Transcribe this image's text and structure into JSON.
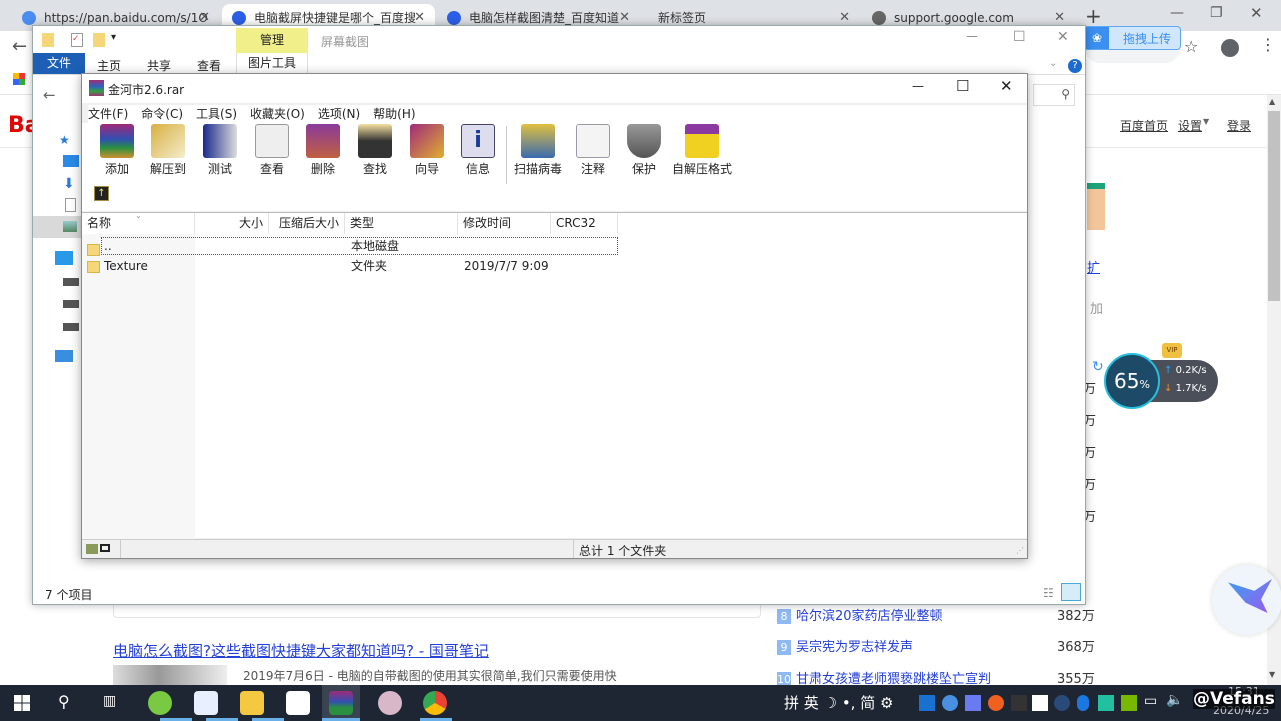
{
  "browser": {
    "tabs": [
      {
        "title": "https://pan.baidu.com/s/1O",
        "icon": "baidu-netdisk-icon"
      },
      {
        "title": "电脑截屏快捷键是哪个_百度搜",
        "icon": "baidu-paw-icon",
        "active": true
      },
      {
        "title": "电脑怎样截图清楚_百度知道",
        "icon": "baidu-paw-icon"
      },
      {
        "title": "新标签页",
        "icon": ""
      },
      {
        "title": "support.google.com",
        "icon": "globe-icon"
      }
    ],
    "upload_button": "拖拽上传"
  },
  "baidu": {
    "logo": "Ba",
    "header_links": [
      "百度首页",
      "设置",
      "登录"
    ],
    "result_title": "电脑怎么截图?这些截图快捷键大家都知道吗? - 国哥笔记",
    "result_snippet": "2019年7月6日 - 电脑的自带截图的使用其实很简单,我们只需要使用快",
    "side_fragments": [
      "扩",
      "加"
    ],
    "hot_list": [
      {
        "rank": "8",
        "title": "哈尔滨20家药店停业整顿",
        "count": "382万"
      },
      {
        "rank": "9",
        "title": "吴宗宪为罗志祥发声",
        "count": "368万"
      },
      {
        "rank": "10",
        "title": "甘肃女孩遭老师猥亵跳楼坠亡宣判",
        "count": "355万"
      }
    ],
    "count_suffix": "万"
  },
  "explorer": {
    "ribbon_tabs": [
      "文件",
      "主页",
      "共享",
      "查看"
    ],
    "context_group": "管理",
    "context_tab": "图片工具",
    "title": "屏幕截图",
    "status": "7 个项目"
  },
  "winrar": {
    "title": "金河市2.6.rar",
    "menu": [
      "文件(F)",
      "命令(C)",
      "工具(S)",
      "收藏夹(O)",
      "选项(N)",
      "帮助(H)"
    ],
    "toolbar": [
      "添加",
      "解压到",
      "测试",
      "查看",
      "删除",
      "查找",
      "向导",
      "信息",
      "扫描病毒",
      "注释",
      "保护",
      "自解压格式"
    ],
    "columns": [
      "名称",
      "大小",
      "压缩后大小",
      "类型",
      "修改时间",
      "CRC32"
    ],
    "rows": [
      {
        "name": "..",
        "size": "",
        "packed": "",
        "type": "本地磁盘",
        "modified": "",
        "crc": ""
      },
      {
        "name": "Texture",
        "size": "",
        "packed": "",
        "type": "文件夹",
        "modified": "2019/7/7 9:09",
        "crc": ""
      }
    ],
    "status": "总计 1 个文件夹"
  },
  "speed_widget": {
    "percent": "65",
    "percent_sign": "%",
    "up": "0.2K/s",
    "down": "1.7K/s",
    "badge": "VIP"
  },
  "taskbar": {
    "ime": [
      "拼",
      "英",
      "☽",
      "•,",
      "简",
      "⚙"
    ],
    "time": "15:31",
    "date": "2020/4/25",
    "watermark": "@Vefans"
  }
}
